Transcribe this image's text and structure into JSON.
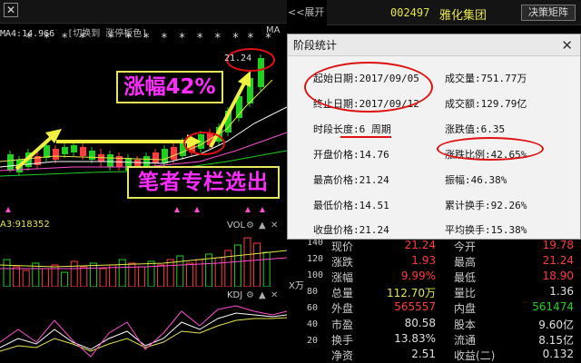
{
  "left_panel": {
    "close_glyph": "✕",
    "expand_label": "<<展开",
    "ma_legend": "MA4:14.966",
    "mode_label": "[切换到 涨停板色]",
    "ma_label": "MA",
    "price_label": "21.24",
    "stars_row1": "* *          * *",
    "stars_row2": "* * * * *  * * *",
    "stars_right": "* *",
    "gain_annotation": "涨幅42%",
    "column_annotation": "笔者专栏选出",
    "vol_indicator": "A3:918352",
    "vol_label": "VOL",
    "kdj_label": "KDJ",
    "vol_axis": [
      "140",
      "120",
      "100",
      "80",
      "60",
      "40",
      "20"
    ],
    "vol_unit": "X万",
    "gear_icon": "⚙",
    "arrow_glyph": "▲"
  },
  "stock": {
    "code": "002497",
    "name": "雅化集团",
    "matrix_button": "决策矩阵"
  },
  "quotes": [
    {
      "l1": "现价",
      "v1": "21.24",
      "c1": "#ff3b3b",
      "l2": "今开",
      "v2": "19.78",
      "c2": "#ff3b3b"
    },
    {
      "l1": "涨跌",
      "v1": "1.93",
      "c1": "#ff3b3b",
      "l2": "最高",
      "v2": "21.24",
      "c2": "#ff3b3b"
    },
    {
      "l1": "涨幅",
      "v1": "9.99%",
      "c1": "#ff3b3b",
      "l2": "最低",
      "v2": "18.90",
      "c2": "#ff3b3b"
    },
    {
      "l1": "总量",
      "v1": "112.70万",
      "c1": "#e6e64a",
      "l2": "量比",
      "v2": "1.36",
      "c2": "#e0e0e0"
    },
    {
      "l1": "外盘",
      "v1": "565557",
      "c1": "#ff3b3b",
      "l2": "内盘",
      "v2": "561474",
      "c2": "#1fd11f"
    },
    {
      "l1": "市盈",
      "v1": "80.58",
      "c1": "#e0e0e0",
      "l2": "股本",
      "v2": "9.60亿",
      "c2": "#e0e0e0"
    },
    {
      "l1": "换手",
      "v1": "13.83%",
      "c1": "#e0e0e0",
      "l2": "流通",
      "v2": "8.15亿",
      "c2": "#e0e0e0"
    },
    {
      "l1": "净资",
      "v1": "2.51",
      "c1": "#e0e0e0",
      "l2": "收益(二)",
      "v2": "0.132",
      "c2": "#e0e0e0"
    }
  ],
  "dialog": {
    "title": "阶段统计",
    "close_glyph": "✕",
    "start_date": "起始日期:2017/09/05",
    "end_date": "终止日期:2017/09/12",
    "duration": "时段长度:6 周期",
    "open_price": "开盘价格:14.76",
    "high_price": "最高价格:21.24",
    "low_price": "最低价格:14.51",
    "close_price": "收盘价格:21.24",
    "volume": "成交量:751.77万",
    "turnover": "成交额:129.79亿",
    "change": "涨跌值:6.35",
    "change_ratio": "涨跌比例:42.65%",
    "amplitude": "振幅:46.38%",
    "cum_turnover": "累计换手:92.26%",
    "avg_turnover": "平均换手:15.38%"
  },
  "colors": {
    "up": "#ff3b3b",
    "down": "#1fd11f",
    "accent_yellow": "#e6e64a",
    "annotation_magenta": "#ff2cff",
    "annotation_red": "#e01010"
  }
}
